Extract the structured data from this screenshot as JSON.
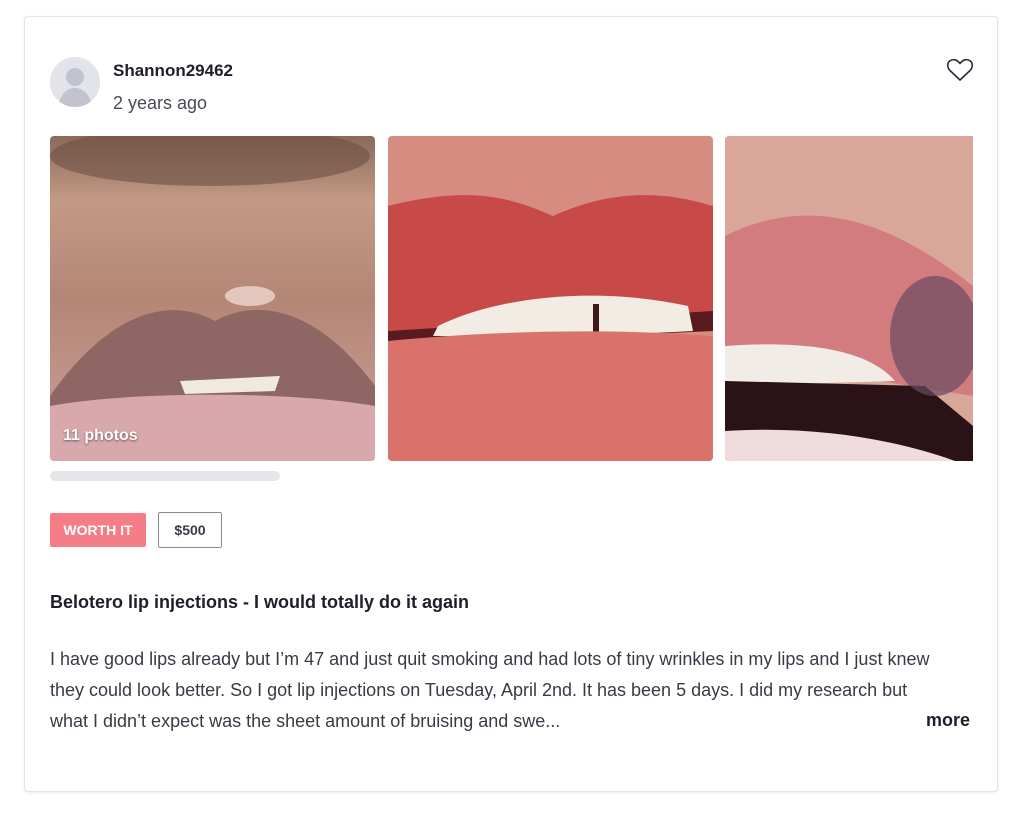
{
  "review": {
    "username": "Shannon29462",
    "time_ago": "2 years ago",
    "photo_count": "11 photos",
    "worth_it_label": "WORTH IT",
    "price": "$500",
    "title": "Belotero lip injections - I would totally do it again",
    "body": "I have good lips already but I’m 47 and just quit smoking and had lots of tiny wrinkles in my lips and I just knew they could look better. So I got lip injections on Tuesday, April 2nd. It has been 5 days. I did my research but what I didn’t expect was the sheet amount of bruising and swe...",
    "more_label": "more"
  },
  "icons": {
    "avatar": "avatar-placeholder-icon",
    "favorite": "heart-icon"
  },
  "colors": {
    "worth_it_badge": "#f57d88",
    "text_primary": "#1e1e2c",
    "border": "#e4e4e8"
  }
}
